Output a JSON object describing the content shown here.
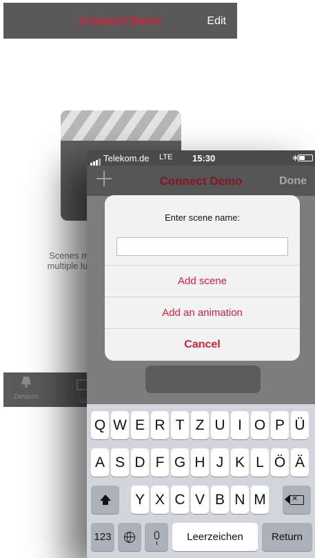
{
  "background": {
    "nav_title": "Connect Demo",
    "edit_label": "Edit",
    "scene_text": "Scenes m\nmultiple lur",
    "tabs": [
      {
        "label": "Devices",
        "icon": "lamp-icon"
      },
      {
        "label": "Ga",
        "icon": "group-icon"
      }
    ]
  },
  "status": {
    "carrier": "Telekom.de",
    "network": "LTE",
    "time": "15:30",
    "bluetooth_icon": "bluetooth-icon"
  },
  "nav": {
    "title": "Connect Demo",
    "done_label": "Done"
  },
  "alert": {
    "title": "Enter scene name:",
    "input_value": "",
    "input_placeholder": "",
    "actions": {
      "add_scene": "Add scene",
      "add_animation": "Add an animation",
      "cancel": "Cancel"
    }
  },
  "keyboard": {
    "row1": [
      "Q",
      "W",
      "E",
      "R",
      "T",
      "Z",
      "U",
      "I",
      "O",
      "P",
      "Ü"
    ],
    "row2": [
      "A",
      "S",
      "D",
      "F",
      "G",
      "H",
      "J",
      "K",
      "L",
      "Ö",
      "Ä"
    ],
    "row3": [
      "Y",
      "X",
      "C",
      "V",
      "B",
      "N",
      "M"
    ],
    "numbers_label": "123",
    "space_label": "Leerzeichen",
    "return_label": "Return"
  },
  "colors": {
    "accent": "#d21f3c",
    "accent_dimmed": "#8e1226"
  }
}
